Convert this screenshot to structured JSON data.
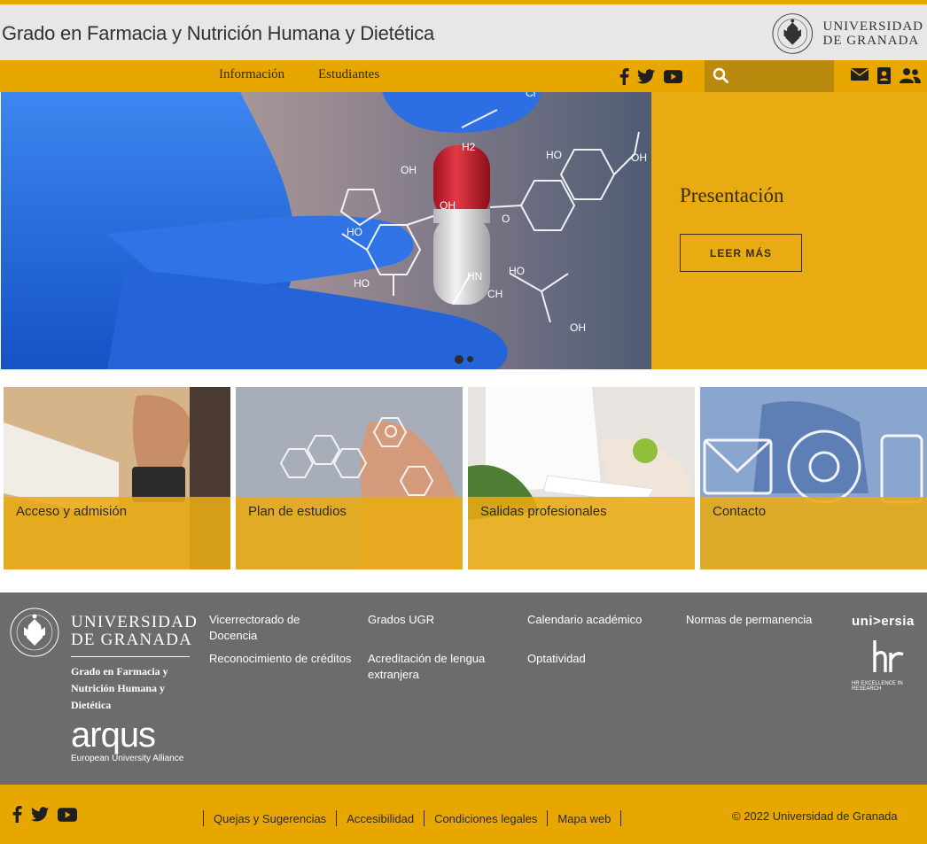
{
  "header": {
    "title": "Grado en Farmacia y Nutrición Humana y Dietética",
    "logo_line1": "UNIVERSIDAD",
    "logo_line2": "DE GRANADA"
  },
  "nav": {
    "items": [
      "Información",
      "Estudiantes"
    ],
    "social_icons": [
      "facebook-icon",
      "twitter-icon",
      "youtube-icon"
    ],
    "search": {
      "value": "",
      "placeholder": ""
    },
    "tool_icons": [
      "envelope-icon",
      "address-book-icon",
      "users-icon"
    ]
  },
  "hero": {
    "title": "Presentación",
    "button": "LEER MÁS",
    "slides": 2,
    "active_slide": 1
  },
  "cards": [
    {
      "label": "Acceso y admisión"
    },
    {
      "label": "Plan de estudios"
    },
    {
      "label": "Salidas profesionales"
    },
    {
      "label": "Contacto"
    }
  ],
  "footer": {
    "ugr_line1": "UNIVERSIDAD",
    "ugr_line2": "DE GRANADA",
    "degree": "Grado en Farmacia y Nutrición Humana y Dietética",
    "arqus": "arqus",
    "arqus_sub": "European University Alliance",
    "links": [
      "Vicerrectorado de Docencia",
      "Grados UGR",
      "Calendario académico",
      "Normas de permanencia",
      "Reconocimiento de créditos",
      "Acreditación de lengua extranjera",
      "Optatividad"
    ],
    "universia": "uni>ersia",
    "hr_text": "HR EXCELLENCE IN RESEARCH"
  },
  "bottom": {
    "links": [
      "Quejas y Sugerencias",
      "Accesibilidad",
      "Condiciones legales",
      "Mapa web"
    ],
    "copyright": "© 2022 Universidad de Granada"
  },
  "colors": {
    "accent": "#e8a700",
    "header_bg": "#e8e6e7",
    "footer_bg": "#6c6c6c",
    "search_bg": "#b98a0e"
  }
}
